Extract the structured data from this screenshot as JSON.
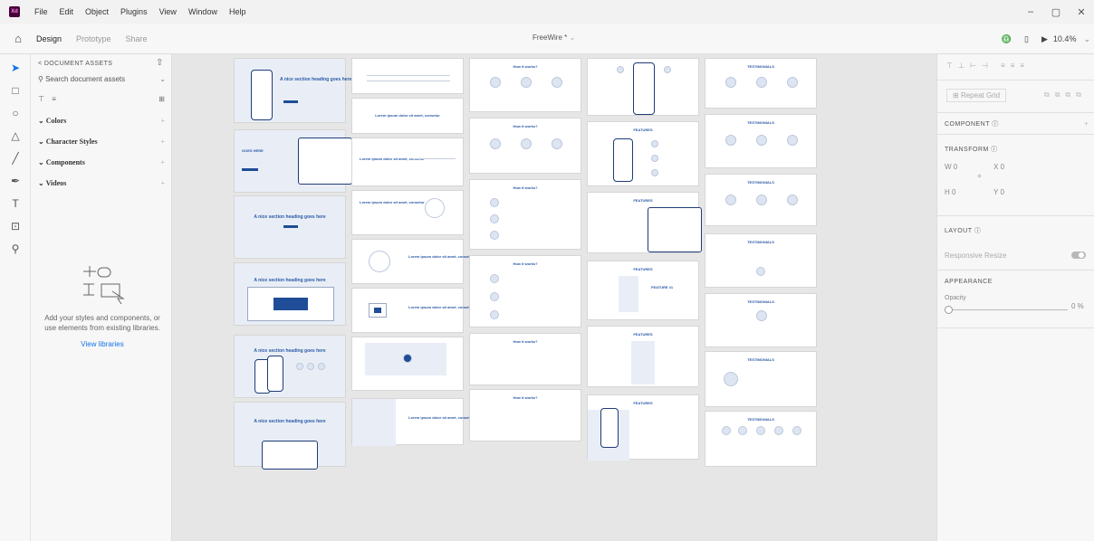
{
  "app": {
    "logo_text": "Xd",
    "menus": [
      "File",
      "Edit",
      "Object",
      "Plugins",
      "View",
      "Window",
      "Help"
    ],
    "window_controls": [
      "–",
      "▢",
      "✕"
    ]
  },
  "tabs": {
    "items": [
      "Design",
      "Prototype",
      "Share"
    ],
    "active": "Design"
  },
  "document": {
    "title": "FreeWire *",
    "title_chevron": "⌄"
  },
  "right_controls": {
    "zoom": "10.4%"
  },
  "left_panel": {
    "header": "< DOCUMENT ASSETS",
    "search_placeholder": "Search document assets",
    "sections": [
      "Colors",
      "Character Styles",
      "Components",
      "Videos"
    ],
    "empty_message": "Add your styles and components, or use elements from existing libraries.",
    "link": "View libraries"
  },
  "right_panel": {
    "repeat_grid": "Repeat Grid",
    "component": "COMPONENT",
    "transform": "TRANSFORM",
    "w_label": "W",
    "w_value": "0",
    "h_label": "H",
    "h_value": "0",
    "x_label": "X",
    "x_value": "0",
    "y_label": "Y",
    "y_value": "0",
    "layout": "LAYOUT",
    "responsive": "Responsive Resize",
    "appearance": "APPEARANCE",
    "opacity_label": "Opacity",
    "opacity_value": "0 %"
  },
  "artboards": {
    "hero_heading": "A nice section heading goes here",
    "hero_heading_alt": "A nice section heading goes here",
    "goes_here": "GOES HERE",
    "how_it_works": "How it works?",
    "features": "FEATURES",
    "testimonials": "TESTIMONIALS",
    "lorem": "Lorem ipsum dolor sit amet, consetur",
    "feature_title": "FEATURE #1"
  },
  "colors": {
    "accent": "#1473e6",
    "brand": "#ff61f6",
    "wire": "#1f4d97"
  }
}
